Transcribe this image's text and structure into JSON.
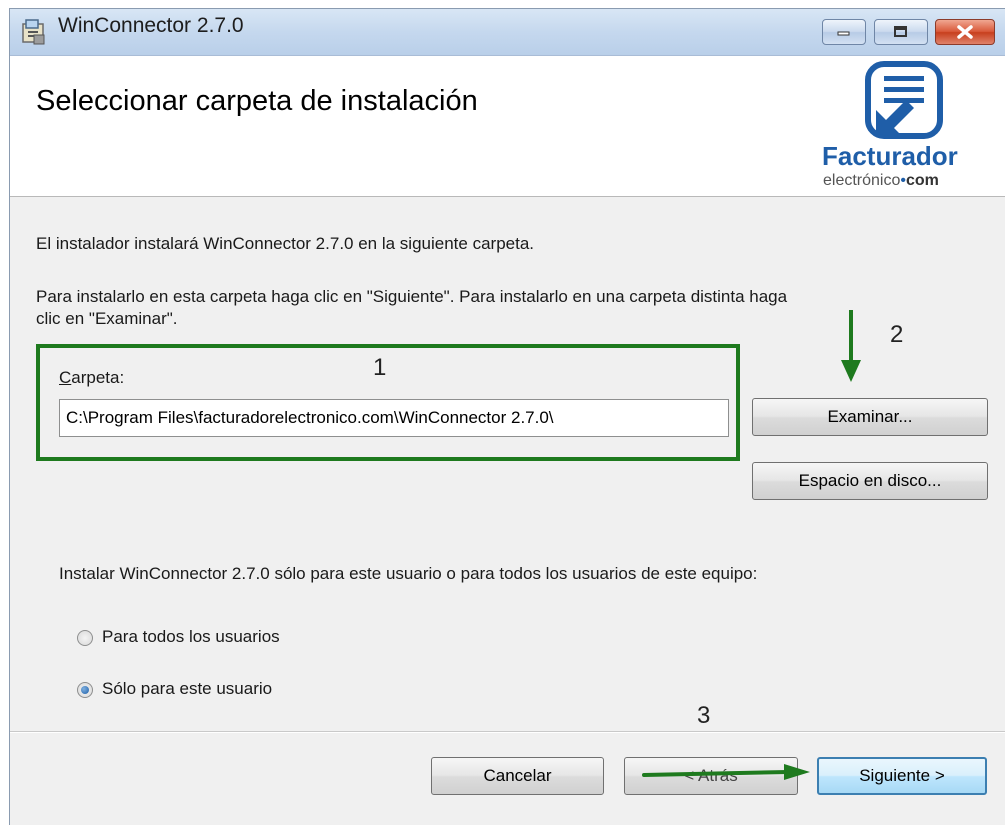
{
  "window": {
    "title": "WinConnector 2.7.0"
  },
  "header": {
    "heading": "Seleccionar carpeta de instalación",
    "logo_word": "Facturador",
    "logo_sub_a": "electrónico",
    "logo_sub_dot": "•",
    "logo_sub_b": "com"
  },
  "body": {
    "intro": "El instalador instalará WinConnector 2.7.0 en la siguiente carpeta.",
    "instructions_line1": "Para instalarlo en esta carpeta haga clic en \"Siguiente\". Para instalarlo en una carpeta distinta haga",
    "instructions_line2": "clic en \"Examinar\".",
    "folder_label_first": "C",
    "folder_label_rest": "arpeta:",
    "folder_value": "C:\\Program Files\\facturadorelectronico.com\\WinConnector 2.7.0\\",
    "browse_label": "Examinar...",
    "disk_space_label": "Espacio en disco...",
    "scope_question": "Instalar WinConnector 2.7.0 sólo para este usuario o para todos los usuarios de este equipo:",
    "radio_all_label": "Para todos los usuarios",
    "radio_me_label": "Sólo para este usuario",
    "selected_radio": "radio_me"
  },
  "footer": {
    "cancel_label": "Cancelar",
    "back_label": "< Atrás",
    "next_label": "Siguiente >"
  },
  "annotations": {
    "mark_1": "1",
    "mark_2": "2",
    "mark_3": "3",
    "highlight_color": "#1e7a1e"
  },
  "icons": [
    "installer-app-icon",
    "minimize-icon",
    "maximize-icon",
    "close-icon",
    "document-arrow-logo-icon",
    "green-arrow-down-icon",
    "green-arrow-right-icon"
  ]
}
